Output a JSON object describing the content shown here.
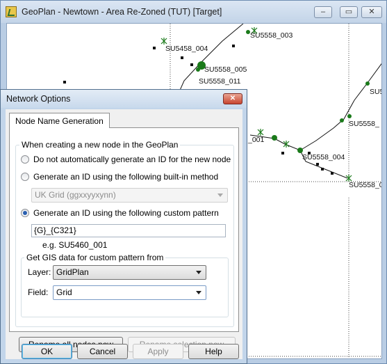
{
  "geoplan": {
    "title": "GeoPlan - Newtown - Area Re-Zoned (TUT) [Target]",
    "controls": {
      "minimize": "–",
      "maximize": "▭",
      "close": "✕"
    },
    "node_labels": [
      "SU5558_003",
      "SU5458_004",
      "SU5558_005",
      "SU5558_011",
      "SU5",
      "SU5558_",
      "_001",
      "SU5558_004",
      "SU5558_0"
    ]
  },
  "dialog": {
    "title": "Network Options",
    "close": "✕",
    "tab": "Node Name Generation",
    "group_main": {
      "legend": "When creating a new node in the GeoPlan"
    },
    "radio_none": "Do not automatically generate an ID for the new node",
    "radio_builtin": "Generate an ID using the following built-in method",
    "builtin_select": "UK Grid (ggxxyyxynn)",
    "radio_custom": "Generate an ID using the following custom pattern",
    "selected_option": "custom",
    "pattern_value": "{G}_{C321}",
    "example": "e.g. SU5460_001",
    "gis_group": {
      "legend": "Get GIS data for custom pattern from",
      "layer_label": "Layer:",
      "layer_value": "GridPlan",
      "field_label": "Field:",
      "field_value": "Grid"
    },
    "rename_all": "Rename all nodes now",
    "rename_selection": "Rename selection now",
    "buttons": {
      "ok": "OK",
      "cancel": "Cancel",
      "apply": "Apply",
      "help": "Help"
    }
  }
}
